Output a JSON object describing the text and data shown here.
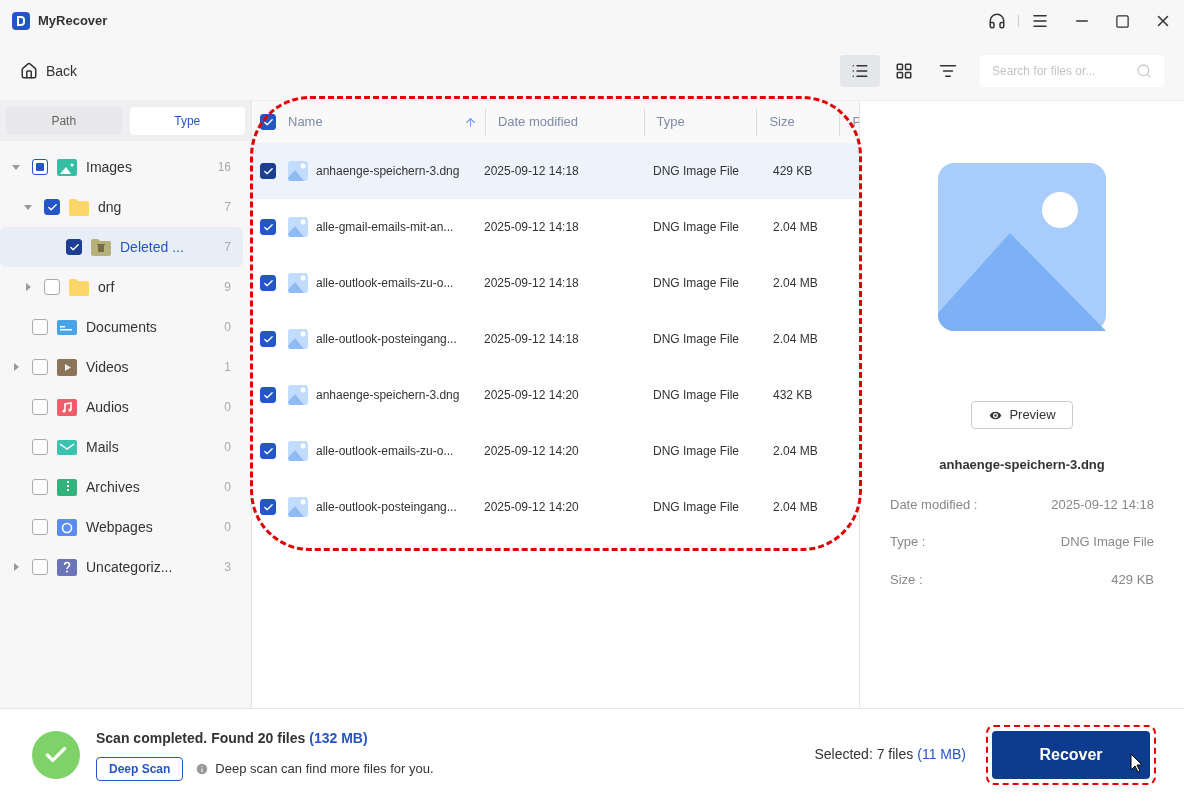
{
  "window": {
    "title": "MyRecover"
  },
  "toolbar": {
    "back": "Back",
    "views": [
      {
        "kind": "list",
        "selected": true
      },
      {
        "kind": "grid",
        "selected": false
      }
    ],
    "search": {
      "placeholder": "Search for files or..."
    }
  },
  "sidebar": {
    "tabs": [
      {
        "label": "Path",
        "selected": false
      },
      {
        "label": "Type",
        "selected": true
      }
    ],
    "items": [
      {
        "label": "Images",
        "count": "16",
        "kind": "images",
        "checked": false,
        "partial": true,
        "expanded": true,
        "selected": false,
        "children": [
          {
            "label": "dng",
            "count": "7",
            "kind": "folder",
            "checked": true,
            "expanded": true,
            "selected": false,
            "children": [
              {
                "label": "Deleted ...",
                "count": "7",
                "kind": "deleted",
                "checked": true,
                "selected": true
              }
            ]
          },
          {
            "label": "orf",
            "count": "9",
            "kind": "folder",
            "checked": false,
            "expanded": false,
            "selected": false
          }
        ]
      },
      {
        "label": "Documents",
        "count": "0",
        "kind": "documents",
        "checked": false,
        "selected": false
      },
      {
        "label": "Videos",
        "count": "1",
        "kind": "videos",
        "checked": false,
        "expanded": false,
        "selected": false
      },
      {
        "label": "Audios",
        "count": "0",
        "kind": "audios",
        "checked": false,
        "selected": false
      },
      {
        "label": "Mails",
        "count": "0",
        "kind": "mails",
        "checked": false,
        "selected": false
      },
      {
        "label": "Archives",
        "count": "0",
        "kind": "archives",
        "checked": false,
        "selected": false
      },
      {
        "label": "Webpages",
        "count": "0",
        "kind": "webpages",
        "checked": false,
        "selected": false
      },
      {
        "label": "Uncategoriz...",
        "count": "3",
        "kind": "uncategorized",
        "checked": false,
        "expanded": false,
        "selected": false
      }
    ]
  },
  "table": {
    "all_checked": true,
    "columns": [
      "Name",
      "Date modified",
      "Type",
      "Size",
      "P"
    ],
    "rows": [
      {
        "name": "anhaenge-speichern-3.dng",
        "date": "2025-09-12 14:18",
        "type": "DNG Image File",
        "size": "429 KB",
        "checked": true,
        "selected": true
      },
      {
        "name": "alle-gmail-emails-mit-an...",
        "date": "2025-09-12 14:18",
        "type": "DNG Image File",
        "size": "2.04 MB",
        "checked": true,
        "selected": false
      },
      {
        "name": "alle-outlook-emails-zu-o...",
        "date": "2025-09-12 14:18",
        "type": "DNG Image File",
        "size": "2.04 MB",
        "checked": true,
        "selected": false
      },
      {
        "name": "alle-outlook-posteingang...",
        "date": "2025-09-12 14:18",
        "type": "DNG Image File",
        "size": "2.04 MB",
        "checked": true,
        "selected": false
      },
      {
        "name": "anhaenge-speichern-3.dng",
        "date": "2025-09-12 14:20",
        "type": "DNG Image File",
        "size": "432 KB",
        "checked": true,
        "selected": false
      },
      {
        "name": "alle-outlook-emails-zu-o...",
        "date": "2025-09-12 14:20",
        "type": "DNG Image File",
        "size": "2.04 MB",
        "checked": true,
        "selected": false
      },
      {
        "name": "alle-outlook-posteingang...",
        "date": "2025-09-12 14:20",
        "type": "DNG Image File",
        "size": "2.04 MB",
        "checked": true,
        "selected": false
      }
    ]
  },
  "preview": {
    "button": "Preview",
    "filename": "anhaenge-speichern-3.dng",
    "details": [
      {
        "label": "Date modified :",
        "value": "2025-09-12 14:18"
      },
      {
        "label": "Type :",
        "value": "DNG Image File"
      },
      {
        "label": "Size :",
        "value": "429 KB"
      }
    ]
  },
  "status": {
    "message": "Scan completed. Found 20 files",
    "size": "(132 MB)",
    "deep_scan": "Deep Scan",
    "hint": "Deep scan can find more files for you.",
    "selected": "Selected: 7 files",
    "selected_size": "(11 MB)",
    "recover": "Recover"
  }
}
